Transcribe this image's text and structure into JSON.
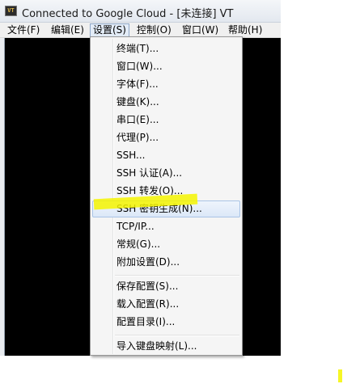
{
  "window": {
    "app_icon_text": "VT",
    "title": "Connected to Google Cloud - [未连接] VT"
  },
  "menubar": {
    "items": [
      {
        "label": "文件(F)"
      },
      {
        "label": "编辑(E)"
      },
      {
        "label": "设置(S)"
      },
      {
        "label": "控制(O)"
      },
      {
        "label": "窗口(W)"
      },
      {
        "label": "帮助(H)"
      }
    ]
  },
  "settings_menu": {
    "items": [
      {
        "label": "终端(T)..."
      },
      {
        "label": "窗口(W)..."
      },
      {
        "label": "字体(F)..."
      },
      {
        "label": "键盘(K)..."
      },
      {
        "label": "串口(E)..."
      },
      {
        "label": "代理(P)..."
      },
      {
        "label": "SSH..."
      },
      {
        "label": "SSH 认证(A)..."
      },
      {
        "label": "SSH 转发(O)..."
      },
      {
        "label": "SSH 密钥生成(N)..."
      },
      {
        "label": "TCP/IP..."
      },
      {
        "label": "常规(G)..."
      },
      {
        "label": "附加设置(D)..."
      },
      {
        "label": "保存配置(S)..."
      },
      {
        "label": "载入配置(R)..."
      },
      {
        "label": "配置目录(I)..."
      },
      {
        "label": "导入键盘映射(L)..."
      }
    ],
    "highlighted_index": 9
  },
  "colors": {
    "highlighter": "#f4f400",
    "terminal_bg": "#000000",
    "menu_bg": "#f5f5f5",
    "highlight_border": "#a9c4e6"
  }
}
